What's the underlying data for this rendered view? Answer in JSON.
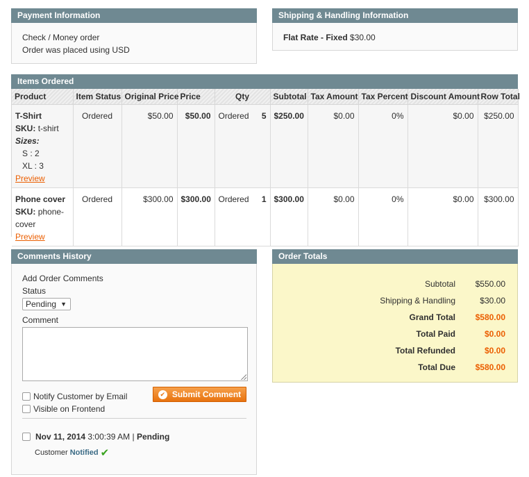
{
  "payment": {
    "title": "Payment Information",
    "method": "Check / Money order",
    "currency_note": "Order was placed using USD"
  },
  "shipping": {
    "title": "Shipping & Handling Information",
    "method": "Flat Rate - Fixed",
    "price": "$30.00"
  },
  "items": {
    "title": "Items Ordered",
    "columns": [
      "Product",
      "Item Status",
      "Original Price",
      "Price",
      "Qty",
      "Subtotal",
      "Tax Amount",
      "Tax Percent",
      "Discount Amount",
      "Row Total"
    ],
    "rows": [
      {
        "name": "T-Shirt",
        "sku_label": "SKU:",
        "sku": "t-shirt",
        "options_label": "Sizes:",
        "options": [
          "S : 2",
          "XL : 3"
        ],
        "preview": "Preview",
        "status": "Ordered",
        "original_price": "$50.00",
        "price": "$50.00",
        "qty_label": "Ordered",
        "qty": "5",
        "subtotal": "$250.00",
        "tax_amount": "$0.00",
        "tax_percent": "0%",
        "discount": "$0.00",
        "row_total": "$250.00"
      },
      {
        "name": "Phone cover",
        "sku_label": "SKU:",
        "sku": "phone-cover",
        "preview": "Preview",
        "status": "Ordered",
        "original_price": "$300.00",
        "price": "$300.00",
        "qty_label": "Ordered",
        "qty": "1",
        "subtotal": "$300.00",
        "tax_amount": "$0.00",
        "tax_percent": "0%",
        "discount": "$0.00",
        "row_total": "$300.00"
      }
    ]
  },
  "comments": {
    "title": "Comments History",
    "add_label": "Add Order Comments",
    "status_label": "Status",
    "status_value": "Pending",
    "comment_label": "Comment",
    "notify_label": "Notify Customer by Email",
    "visible_label": "Visible on Frontend",
    "submit_label": "Submit Comment",
    "history": {
      "date": "Nov 11, 2014",
      "time": "3:00:39 AM",
      "separator": "|",
      "status": "Pending",
      "customer_label": "Customer",
      "notified_label": "Notified"
    }
  },
  "totals": {
    "title": "Order Totals",
    "rows": [
      {
        "label": "Subtotal",
        "value": "$550.00"
      },
      {
        "label": "Shipping & Handling",
        "value": "$30.00"
      },
      {
        "label": "Grand Total",
        "value": "$580.00"
      },
      {
        "label": "Total Paid",
        "value": "$0.00"
      },
      {
        "label": "Total Refunded",
        "value": "$0.00"
      },
      {
        "label": "Total Due",
        "value": "$580.00"
      }
    ]
  },
  "colors": {
    "header_bg": "#6f8992",
    "accent": "#eb5e00",
    "totals_bg": "#fbf7c9"
  }
}
